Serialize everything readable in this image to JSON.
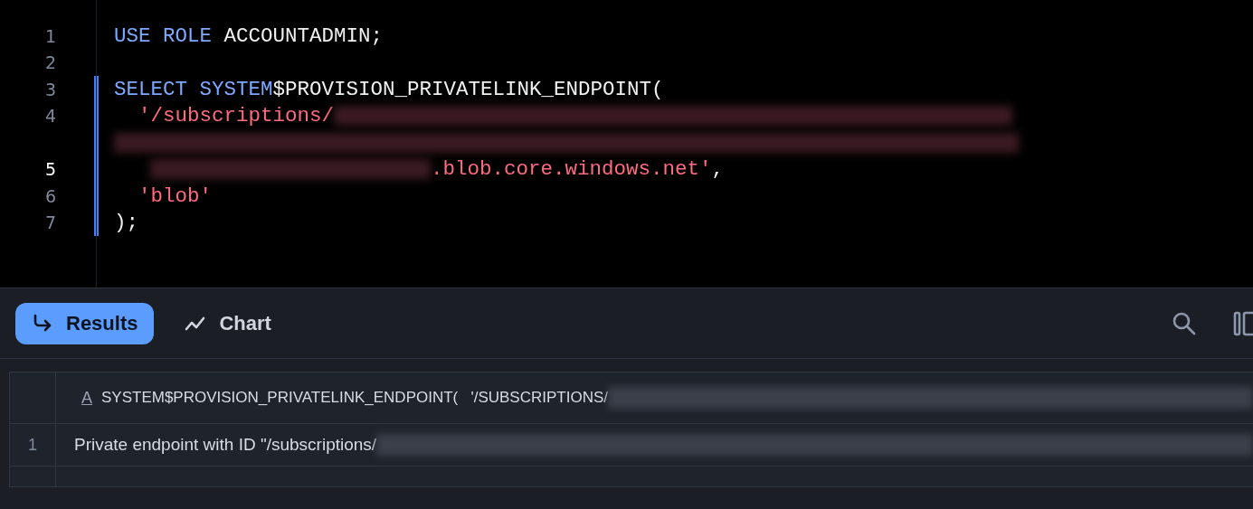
{
  "editor": {
    "lines": [
      {
        "number": "1",
        "active": false,
        "marked": false,
        "tokens": [
          {
            "kind": "keyword",
            "text": "USE ROLE"
          },
          {
            "kind": "plain",
            "text": " ACCOUNTADMIN;"
          }
        ]
      },
      {
        "number": "2",
        "active": false,
        "marked": false
      },
      {
        "number": "3",
        "active": false,
        "marked": true,
        "tokens": [
          {
            "kind": "keyword",
            "text": "SELECT SYSTEM"
          },
          {
            "kind": "plain",
            "text": "$PROVISION_PRIVATELINK_ENDPOINT("
          }
        ]
      },
      {
        "number": "4",
        "active": false,
        "marked": true,
        "tokens": [
          {
            "kind": "string",
            "text": "  '/subscriptions/"
          },
          {
            "kind": "redacted"
          }
        ]
      },
      {
        "marked": true,
        "tokens": [
          {
            "kind": "redacted"
          }
        ]
      },
      {
        "number": "5",
        "active": true,
        "marked": true,
        "tokens": [
          {
            "kind": "redacted"
          },
          {
            "kind": "string",
            "text": ".blob.core.windows.net'"
          },
          {
            "kind": "plain",
            "text": ","
          }
        ]
      },
      {
        "number": "6",
        "active": false,
        "marked": true,
        "tokens": [
          {
            "kind": "string",
            "text": "  'blob'"
          }
        ]
      },
      {
        "number": "7",
        "active": false,
        "marked": true,
        "tokens": [
          {
            "kind": "plain",
            "text": ");"
          }
        ]
      }
    ]
  },
  "results": {
    "tabs": [
      {
        "label": "Results",
        "selected": true
      },
      {
        "label": "Chart",
        "selected": false
      }
    ],
    "table": {
      "columns": [
        {
          "type_icon": "A",
          "name": "SYSTEM$PROVISION_PRIVATELINK_ENDPOINT(   '/SUBSCRIPTIONS/"
        }
      ],
      "rows": [
        {
          "number": "1",
          "cells": [
            "Private endpoint with ID \"/subscriptions/"
          ]
        }
      ]
    }
  }
}
